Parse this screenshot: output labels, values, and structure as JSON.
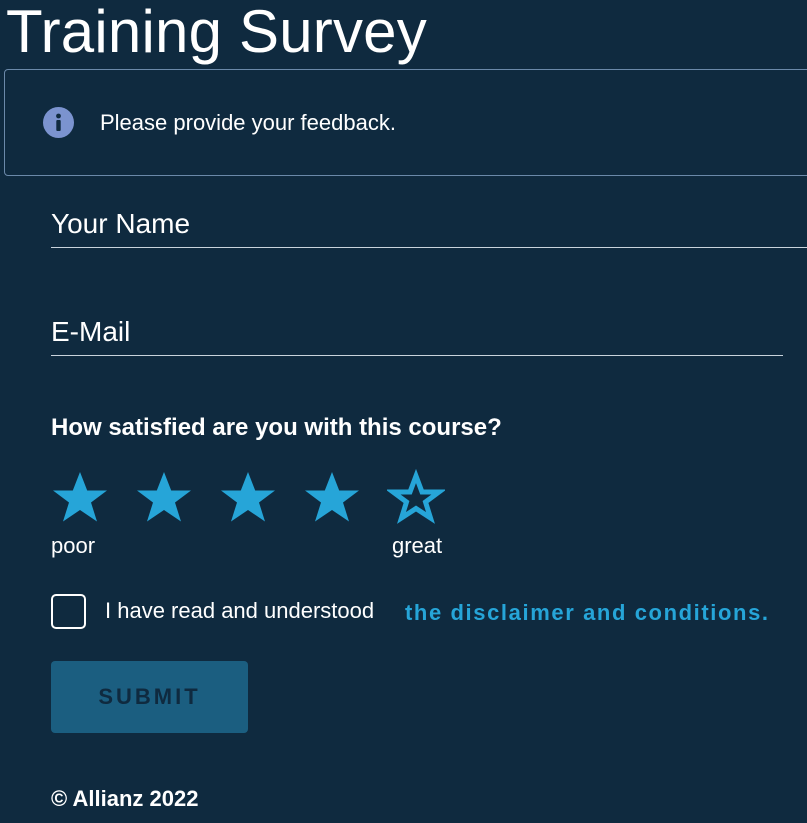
{
  "page": {
    "title": "Training Survey"
  },
  "info": {
    "icon": "info-icon",
    "message": "Please provide your feedback."
  },
  "form": {
    "name_placeholder": "Your Name",
    "email_placeholder": "E-Mail",
    "question": "How satisfied are you with this course?",
    "rating": {
      "max": 5,
      "value": 4,
      "low_label": "poor",
      "high_label": "great",
      "icon": "star-icon"
    },
    "consent": {
      "checked": false,
      "text": "I have read and understood",
      "link_text": "the disclaimer and conditions."
    },
    "submit_label": "SUBMIT"
  },
  "footer": {
    "text": "© Allianz 2022"
  },
  "colors": {
    "background": "#0f2a3f",
    "accent": "#26a5d8",
    "info_icon": "#7b93cf",
    "submit_disabled": "#1b5e80"
  }
}
